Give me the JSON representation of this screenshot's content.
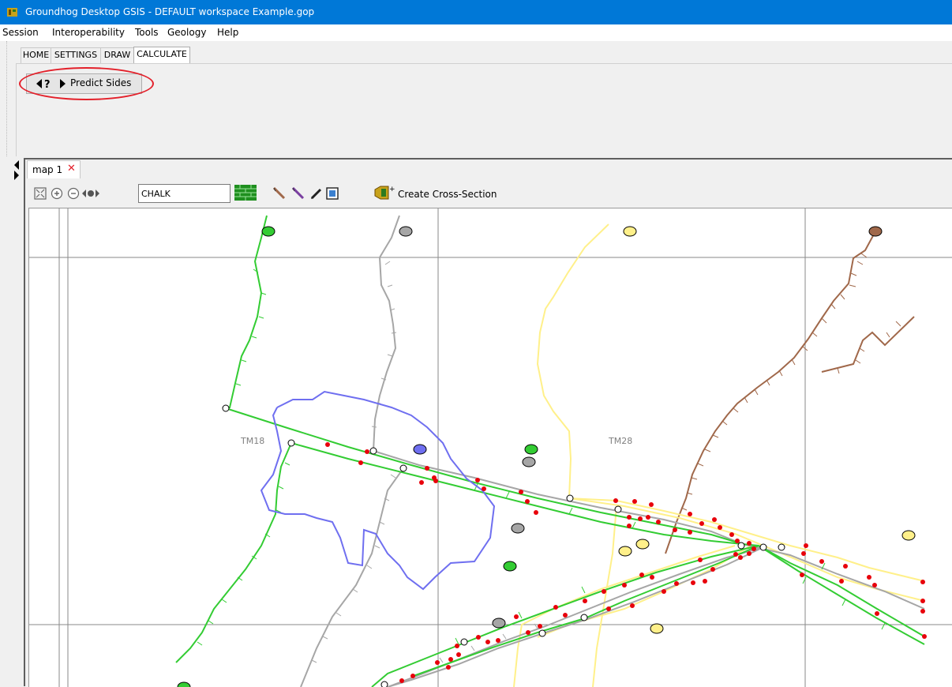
{
  "window": {
    "title": "Groundhog Desktop GSIS - DEFAULT workspace Example.gop",
    "icon": "groundhog-app-icon"
  },
  "menu": [
    "Session",
    "Interoperability",
    "Tools",
    "Geology",
    "Help"
  ],
  "ribbon": {
    "tabs": [
      "HOME",
      "SETTINGS",
      "DRAW",
      "CALCULATE"
    ],
    "active_tab": "CALCULATE",
    "predict_sides_label": "Predict Sides",
    "predict_sides_icon": "arrow-question-arrow-icon",
    "highlight_color": "#e3202a"
  },
  "map_tab": {
    "label": "map 1",
    "close": "✕"
  },
  "map_toolbar": {
    "layer_value": "CHALK",
    "create_cross_section_label": "Create Cross-Section",
    "icons": [
      "zoom-extent-icon",
      "zoom-in-icon",
      "zoom-out-icon",
      "pan-arrows-icon",
      "geology-layer-icon",
      "draw-line-brown-icon",
      "draw-line-purple-icon",
      "pen-icon",
      "frame-icon",
      "cross-section-icon"
    ]
  },
  "map": {
    "grid_labels": [
      "TM18",
      "TM28"
    ],
    "colors": {
      "green": "#33cc33",
      "grey": "#a6a6a6",
      "yellow": "#fff08a",
      "brown": "#a0684a",
      "blue": "#6f6ff0",
      "red": "#e8000b"
    }
  }
}
